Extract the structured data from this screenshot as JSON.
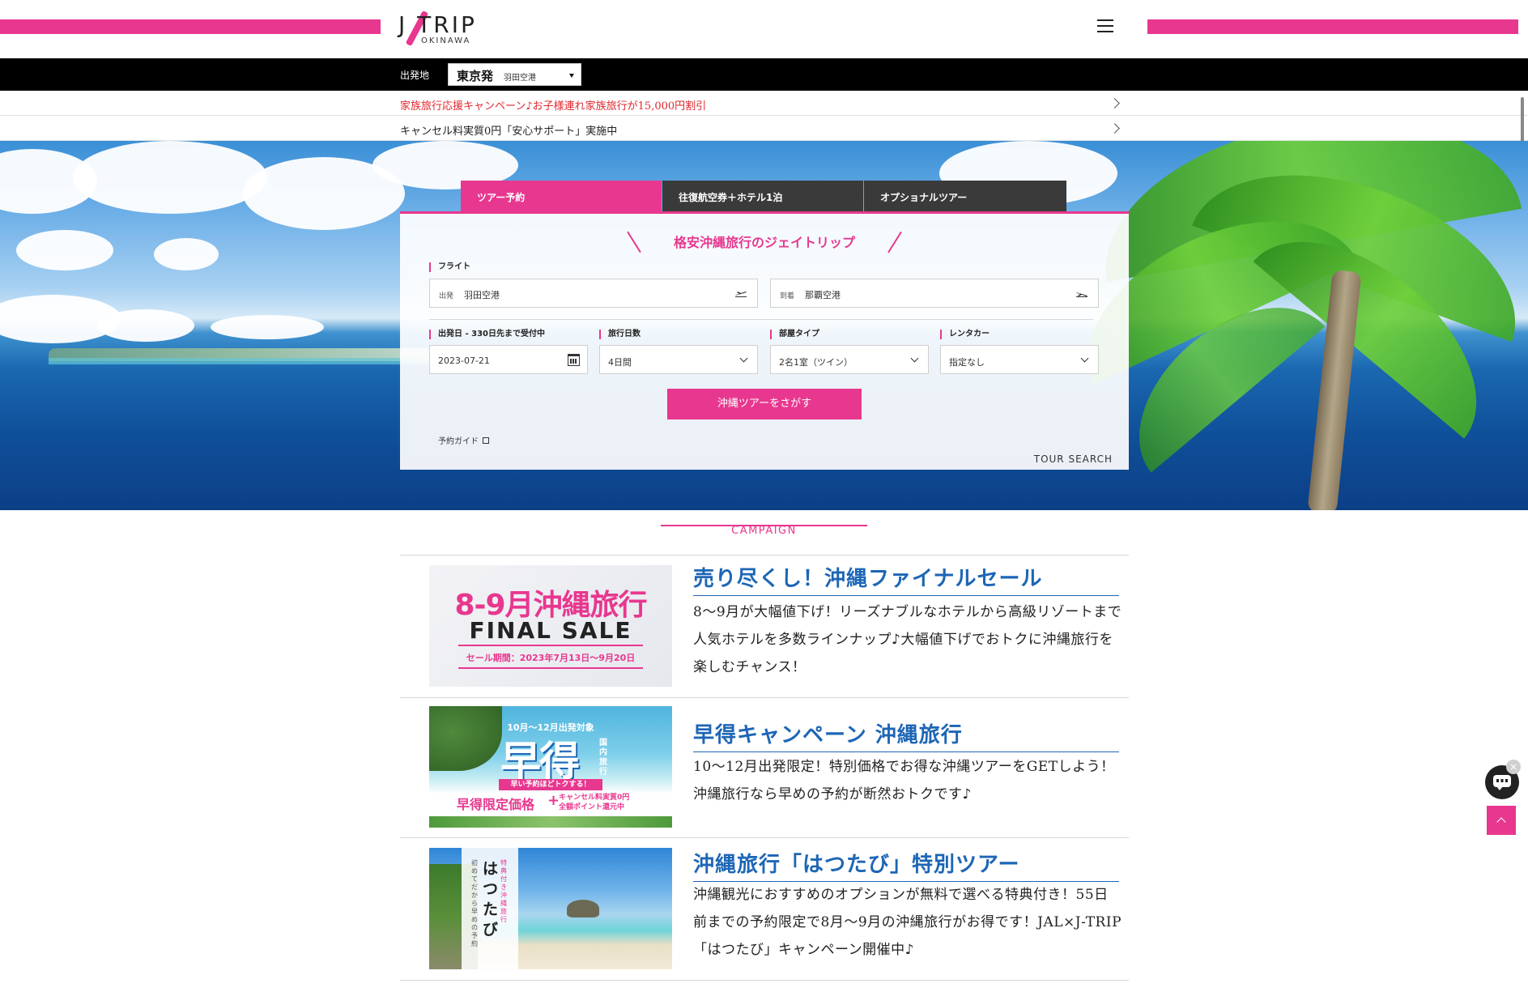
{
  "header": {
    "logo_main": "J TRIP",
    "logo_sub": "OKINAWA",
    "accent": "#e8378f"
  },
  "departure": {
    "label": "出発地",
    "city": "東京発",
    "airport": "羽田空港"
  },
  "notices": [
    {
      "text": "家族旅行応援キャンペーン♪お子様連れ家族旅行が15,000円割引"
    },
    {
      "text": "キャンセル料実質0円「安心サポート」実施中"
    }
  ],
  "tabs": [
    {
      "label": "ツアー予約"
    },
    {
      "label": "往復航空券＋ホテル1泊"
    },
    {
      "label": "オプショナルツアー"
    }
  ],
  "search": {
    "title": "格安沖縄旅行のジェイトリップ",
    "flight_label": "フライト",
    "depart_prefix": "出発",
    "depart_value": "羽田空港",
    "arrive_prefix": "到着",
    "arrive_value": "那覇空港",
    "date_label": "出発日 - 330日先まで受付中",
    "date_value": "2023-07-21",
    "days_label": "旅行日数",
    "days_value": "4日間",
    "room_label": "部屋タイプ",
    "room_value": "2名1室（ツイン）",
    "car_label": "レンタカー",
    "car_value": "指定なし",
    "button": "沖縄ツアーをさがす",
    "guide": "予約ガイド",
    "tour_search": "TOUR SEARCH"
  },
  "campaign": {
    "heading": "CAMPAIGN",
    "items": [
      {
        "title": "売り尽くし！沖縄ファイナルセール",
        "desc": "8〜9月が大幅値下げ！リーズナブルなホテルから高級リゾートまで人気ホテルを多数ラインナップ♪大幅値下げでおトクに沖縄旅行を楽しむチャンス！",
        "banner_heading": "8-9月沖縄旅行",
        "banner_sub": "FINAL SALE",
        "banner_period": "セール期間：2023年7月13日〜9月20日"
      },
      {
        "title": "早得キャンペーン 沖縄旅行",
        "desc": "10〜12月出発限定！特別価格でお得な沖縄ツアーをGETしよう！沖縄旅行なら早めの予約が断然おトクです♪",
        "banner_top": "10月〜12月出発対象",
        "banner_big": "早得",
        "banner_side": "国内旅行",
        "banner_ribbon": "早い予約ほどトクする！",
        "banner_left": "早得限定価格",
        "banner_plus": "+",
        "banner_right_1": "キャンセル料実質0円",
        "banner_right_2": "全額ポイント還元中"
      },
      {
        "title": "沖縄旅行「はつたび」特別ツアー",
        "desc": "沖縄観光におすすめのオプションが無料で選べる特典付き！55日前までの予約限定で8月〜9月の沖縄旅行がお得です！JAL×J-TRIP「はつたび」キャンペーン開催中♪",
        "banner_vertical": "はつたび",
        "banner_vertical_sm": "特典付き 沖縄旅行",
        "banner_vertical_sm2": "初めてだから早めの予約"
      }
    ]
  },
  "widgets": {
    "chat_close": "×"
  }
}
